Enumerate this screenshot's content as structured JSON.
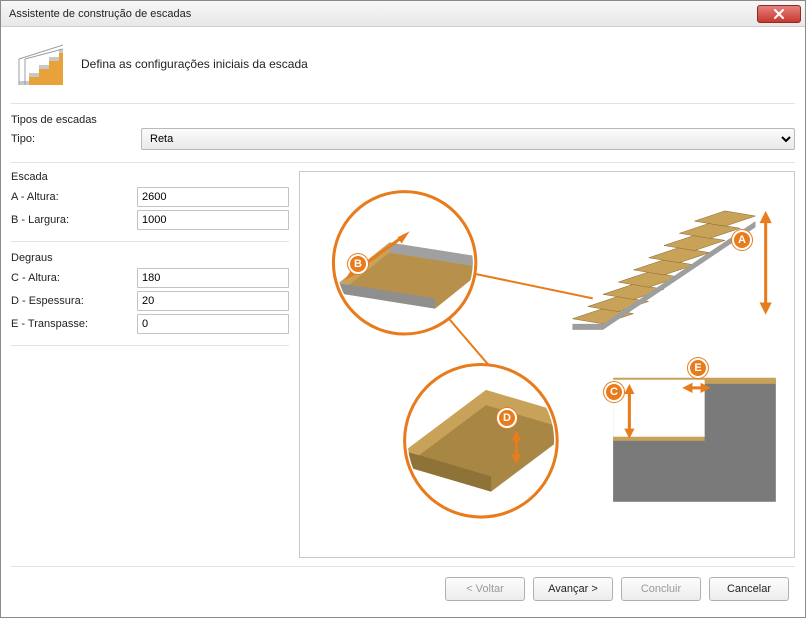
{
  "window": {
    "title": "Assistente de construção de escadas"
  },
  "header": {
    "subtitle": "Defina as configurações iniciais da escada"
  },
  "types": {
    "group_label": "Tipos de escadas",
    "label": "Tipo:",
    "selected": "Reta"
  },
  "escada": {
    "title": "Escada",
    "altura_label": "A - Altura:",
    "altura_value": "2600",
    "largura_label": "B - Largura:",
    "largura_value": "1000"
  },
  "degraus": {
    "title": "Degraus",
    "altura_label": "C - Altura:",
    "altura_value": "180",
    "espessura_label": "D - Espessura:",
    "espessura_value": "20",
    "transpasse_label": "E - Transpasse:",
    "transpasse_value": "0"
  },
  "badges": {
    "a": "A",
    "b": "B",
    "c": "C",
    "d": "D",
    "e": "E"
  },
  "buttons": {
    "back": "< Voltar",
    "next": "Avançar >",
    "finish": "Concluir",
    "cancel": "Cancelar"
  }
}
